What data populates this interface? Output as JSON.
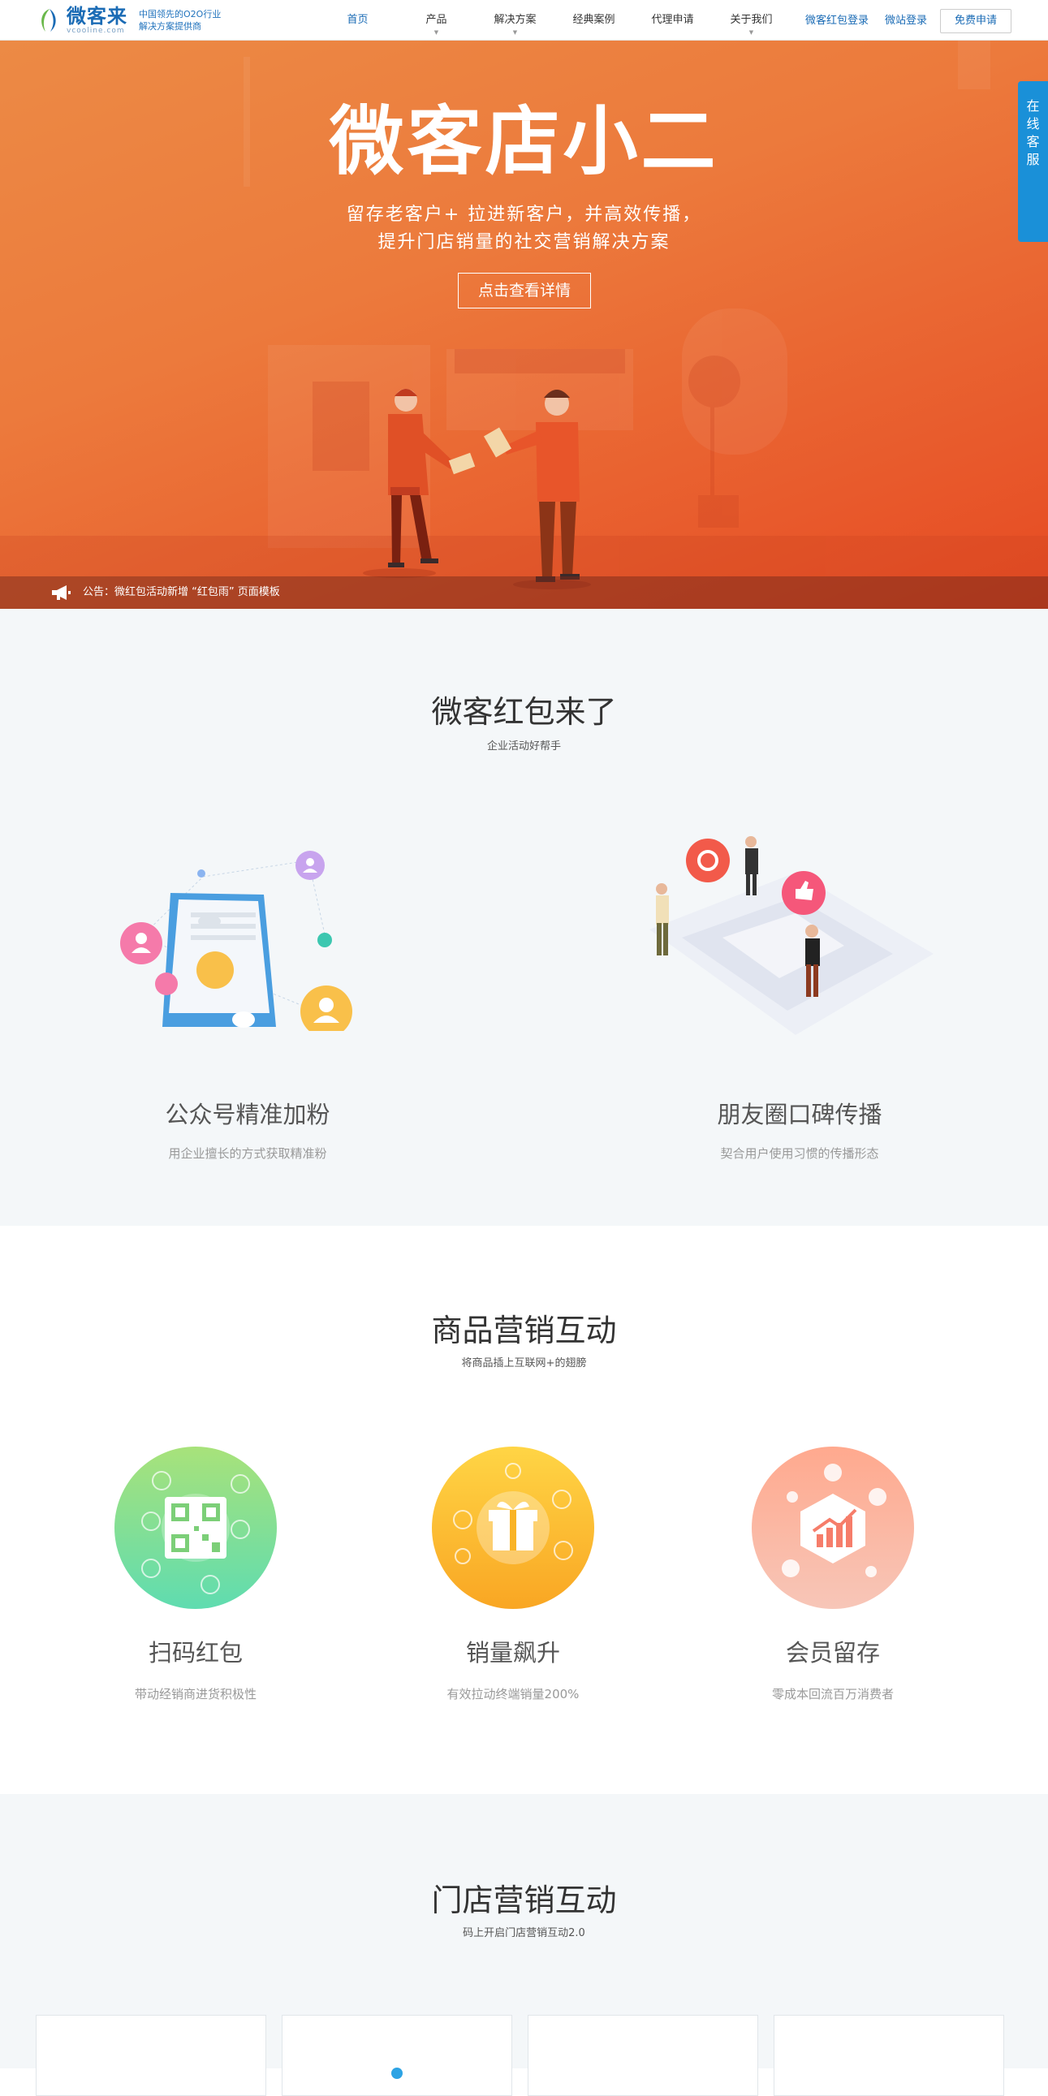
{
  "header": {
    "logo_name": "微客来",
    "logo_domain": "vcooline.com",
    "slogan_line1": "中国领先的O2O行业",
    "slogan_line2": "解决方案提供商",
    "nav": [
      "首页",
      "产品",
      "解决方案",
      "经典案例",
      "代理申请",
      "关于我们"
    ],
    "login_redpack": "微客红包登录",
    "login_site": "微站登录",
    "apply": "免费申请"
  },
  "hero": {
    "title": "微客店小二",
    "subtitle_line1": "留存老客户+ 拉进新客户，并高效传播，",
    "subtitle_line2": "提升门店销量的社交营销解决方案",
    "cta": "点击查看详情",
    "announcement": "公告：微红包活动新增 “红包雨” 页面模板"
  },
  "service_tab": [
    "在",
    "线",
    "客",
    "服"
  ],
  "section_redpack": {
    "title": "微客红包来了",
    "subtitle": "企业活动好帮手",
    "features": [
      {
        "title": "公众号精准加粉",
        "desc": "用企业擅长的方式获取精准粉"
      },
      {
        "title": "朋友圈口碑传播",
        "desc": "契合用户使用习惯的传播形态"
      }
    ]
  },
  "section_goods": {
    "title": "商品营销互动",
    "subtitle": "将商品插上互联网+的翅膀",
    "features": [
      {
        "title": "扫码红包",
        "desc": "带动经销商进货积极性"
      },
      {
        "title": "销量飙升",
        "desc": "有效拉动终端销量200%"
      },
      {
        "title": "会员留存",
        "desc": "零成本回流百万消费者"
      }
    ]
  },
  "section_store": {
    "title": "门店营销互动",
    "subtitle": "码上开启门店营销互动2.0"
  },
  "colors": {
    "brand_blue": "#1a6bb5",
    "hero_orange": "#e8642e",
    "service_blue": "#1a90d8",
    "section_bg": "#f4f7f9"
  }
}
